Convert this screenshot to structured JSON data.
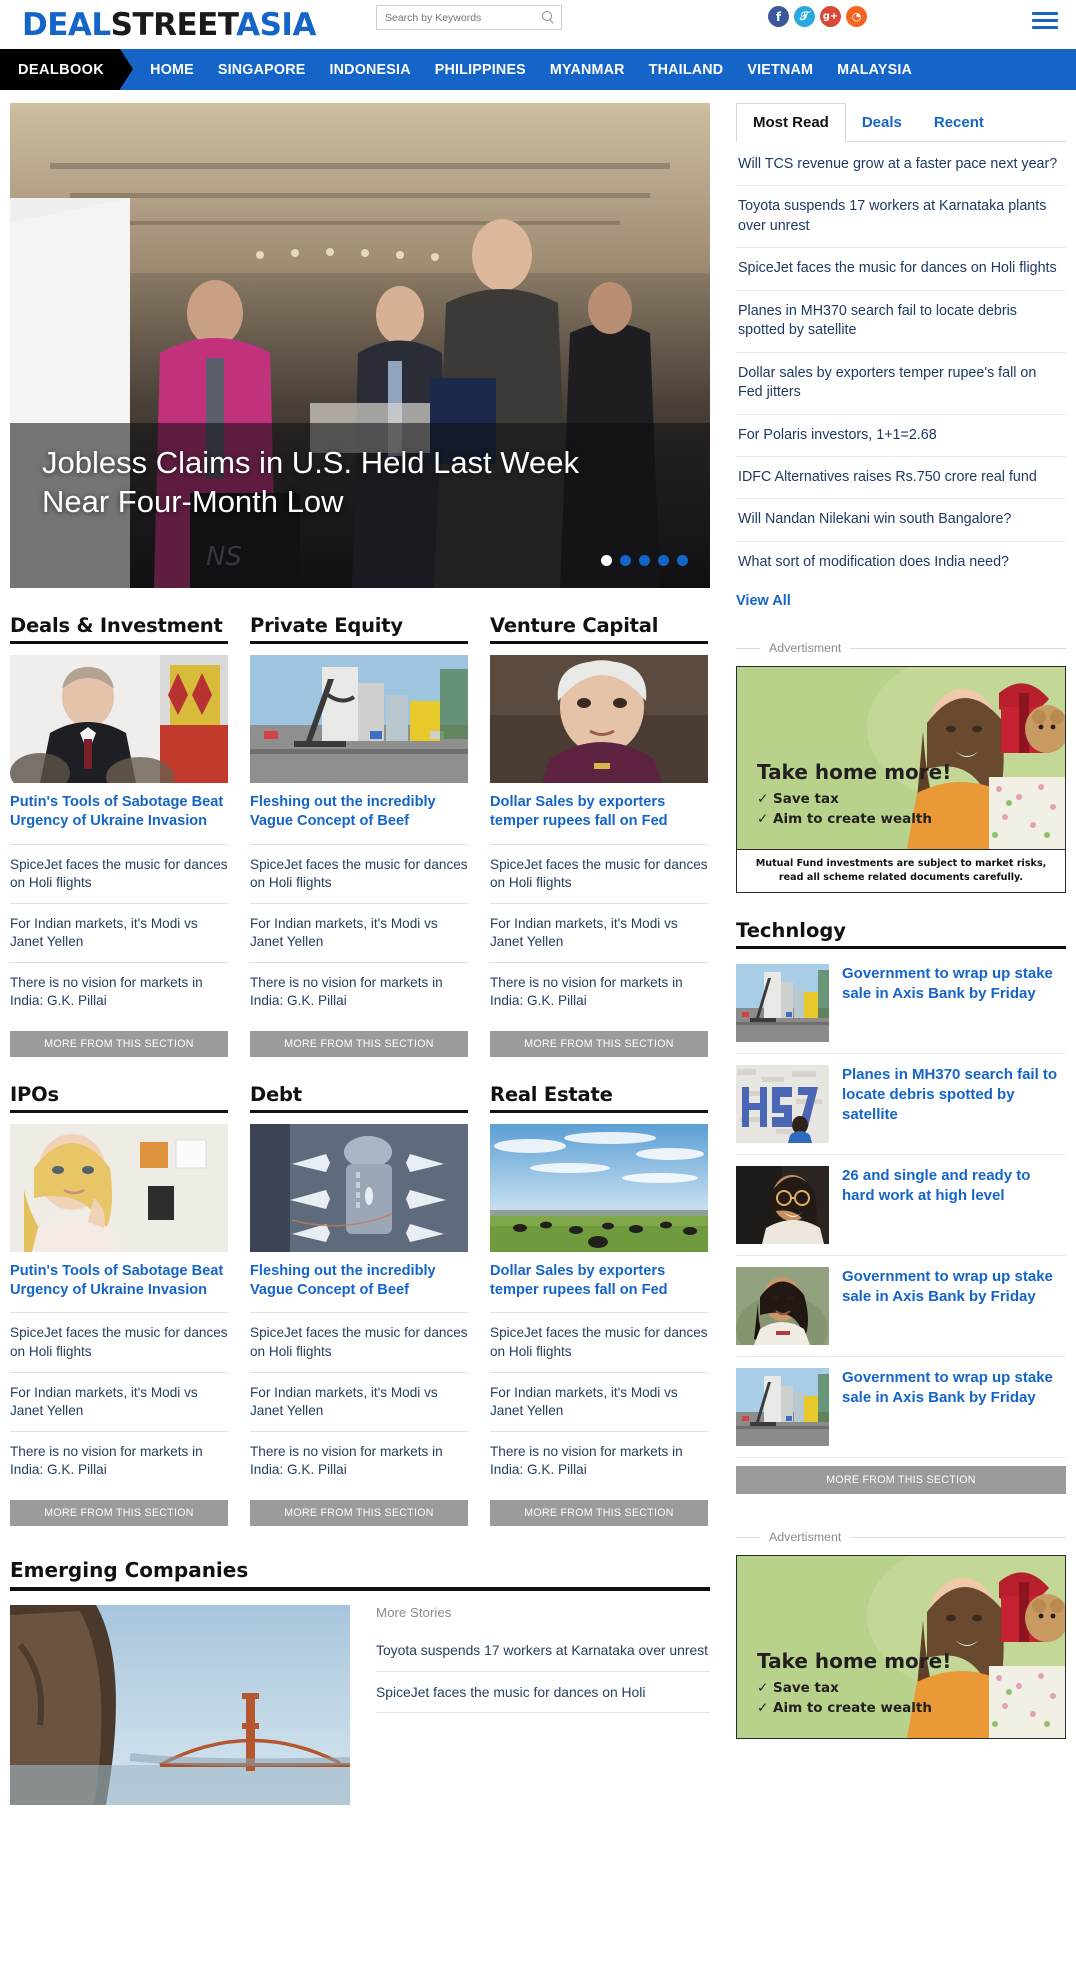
{
  "header": {
    "logo_part1": "DEAL",
    "logo_part2": "STREET",
    "logo_part3": "ASIA",
    "search_placeholder": "Search by Keywords",
    "search_value": "",
    "social": [
      {
        "name": "facebook-icon",
        "glyph": "f"
      },
      {
        "name": "twitter-icon",
        "glyph": "t"
      },
      {
        "name": "googleplus-icon",
        "glyph": "g+"
      },
      {
        "name": "rss-icon",
        "glyph": "◔"
      }
    ]
  },
  "nav": {
    "brand": "DEALBOOK",
    "items": [
      "HOME",
      "SINGAPORE",
      "INDONESIA",
      "PHILIPPINES",
      "MYANMAR",
      "THAILAND",
      "VIETNAM",
      "MALAYSIA"
    ]
  },
  "hero": {
    "caption": "Jobless Claims in U.S. Held Last Week Near Four-Month Low",
    "slide_count": 5,
    "active_slide": 1
  },
  "sidebar": {
    "tabs": [
      {
        "label": "Most Read",
        "active": true
      },
      {
        "label": "Deals",
        "active": false
      },
      {
        "label": "Recent",
        "active": false
      }
    ],
    "most_read": [
      "Will TCS revenue grow at a faster pace next year?",
      "Toyota suspends 17 workers at Karnataka plants over unrest",
      "SpiceJet faces the music for dances on Holi flights",
      "Planes in MH370 search fail to locate debris spotted by satellite",
      "Dollar sales by exporters temper rupee's fall on Fed jitters",
      "For Polaris investors, 1+1=2.68",
      "IDFC Alternatives raises Rs.750 crore real fund",
      "Will Nandan Nilekani win south Bangalore?",
      "What sort of modification does India need?"
    ],
    "view_all": "View All"
  },
  "advertisement": {
    "label": "Advertisment",
    "headline": "Take home more!",
    "bullets": [
      "✓ Save tax",
      "✓ Aim to create wealth"
    ],
    "disclaimer_line1": "Mutual Fund investments are subject to market risks,",
    "disclaimer_line2": "read all scheme related documents carefully."
  },
  "technology": {
    "title": "Technlogy",
    "items": [
      {
        "headline": "Government to wrap up stake sale in Axis Bank by Friday",
        "thumb": "city-tower"
      },
      {
        "headline": "Planes in MH370 search fail to locate debris spotted by satellite",
        "thumb": "mh370-wall"
      },
      {
        "headline": "26 and single and ready to hard work at high level",
        "thumb": "woman-glasses"
      },
      {
        "headline": "Government to wrap up stake sale in Axis Bank by Friday",
        "thumb": "woman-portrait"
      },
      {
        "headline": "Government to wrap up stake sale in Axis Bank by Friday",
        "thumb": "city-tower"
      }
    ],
    "more_label": "MORE FROM THIS SECTION"
  },
  "sections_row1": [
    {
      "title": "Deals & Investment",
      "thumb": "putin",
      "lead": "Putin's Tools of Sabotage Beat Urgency of Ukraine Invasion",
      "items": [
        "SpiceJet faces the music for dances on Holi flights",
        "For Indian markets, it's Modi vs Janet Yellen",
        "There is no vision for markets in India: G.K. Pillai"
      ],
      "more_label": "MORE FROM THIS SECTION"
    },
    {
      "title": "Private Equity",
      "thumb": "city-tower",
      "lead": "Fleshing out the incredibly Vague Concept of Beef",
      "items": [
        "SpiceJet faces the music for dances on Holi flights",
        "For Indian markets, it's Modi vs Janet Yellen",
        "There is no vision for markets in India: G.K. Pillai"
      ],
      "more_label": "MORE FROM THIS SECTION"
    },
    {
      "title": "Venture Capital",
      "thumb": "yellen",
      "lead": "Dollar Sales by exporters temper rupees fall on Fed",
      "items": [
        "SpiceJet faces the music for dances on Holi flights",
        "For Indian markets, it's Modi vs Janet Yellen",
        "There is no vision for markets in India: G.K. Pillai"
      ],
      "more_label": "MORE FROM THIS SECTION"
    }
  ],
  "sections_row2": [
    {
      "title": "IPOs",
      "thumb": "blonde-woman",
      "lead": "Putin's Tools of Sabotage Beat Urgency of Ukraine Invasion",
      "items": [
        "SpiceJet faces the music for dances on Holi flights",
        "For Indian markets, it's Modi vs Janet Yellen",
        "There is no vision for markets in India: G.K. Pillai"
      ],
      "more_label": "MORE FROM THIS SECTION"
    },
    {
      "title": "Debt",
      "thumb": "airport-aerial",
      "lead": "Fleshing out the incredibly Vague Concept of Beef",
      "items": [
        "SpiceJet faces the music for dances on Holi flights",
        "For Indian markets, it's Modi vs Janet Yellen",
        "There is no vision for markets in India: G.K. Pillai"
      ],
      "more_label": "MORE FROM THIS SECTION"
    },
    {
      "title": "Real Estate",
      "thumb": "cattle-field",
      "lead": "Dollar Sales by exporters temper rupees fall on Fed",
      "items": [
        "SpiceJet faces the music for dances on Holi flights",
        "For Indian markets, it's Modi vs Janet Yellen",
        "There is no vision for markets in India: G.K. Pillai"
      ],
      "more_label": "MORE FROM THIS SECTION"
    }
  ],
  "emerging": {
    "title": "Emerging Companies",
    "more_stories_label": "More Stories",
    "items": [
      "Toyota suspends 17 workers at Karnataka over unrest",
      "SpiceJet faces the music for dances on Holi"
    ]
  },
  "colors": {
    "brand_blue": "#1565c8",
    "nav_blue": "#1565c8",
    "dealbook_black": "#000000",
    "link_blue": "#1565c8",
    "body_navy": "#25405f",
    "button_gray": "#9b9b9b"
  }
}
